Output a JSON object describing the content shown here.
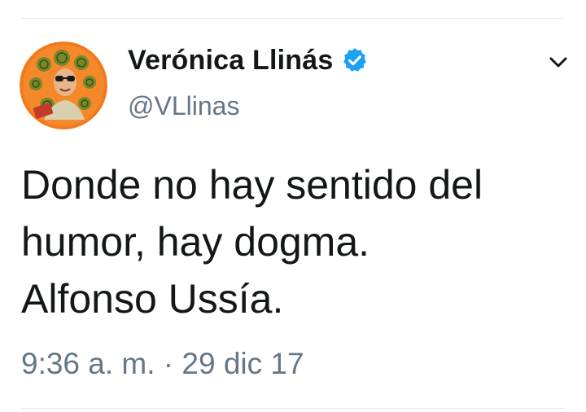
{
  "tweet": {
    "author": {
      "display_name": "Verónica Llinás",
      "handle": "@VLlinas",
      "verified": true
    },
    "text_lines": [
      "Donde no hay sentido del",
      "humor, hay dogma.",
      "Alfonso Ussía."
    ],
    "time": "9:36 a. m.",
    "separator": " · ",
    "date": "29 dic 17"
  },
  "icons": {
    "verified": "verified-badge-icon",
    "menu": "chevron-down-icon"
  },
  "colors": {
    "verified_blue": "#1da1f2",
    "avatar_background": "#f07a1e",
    "secondary_text": "#657786",
    "primary_text": "#14171a"
  }
}
